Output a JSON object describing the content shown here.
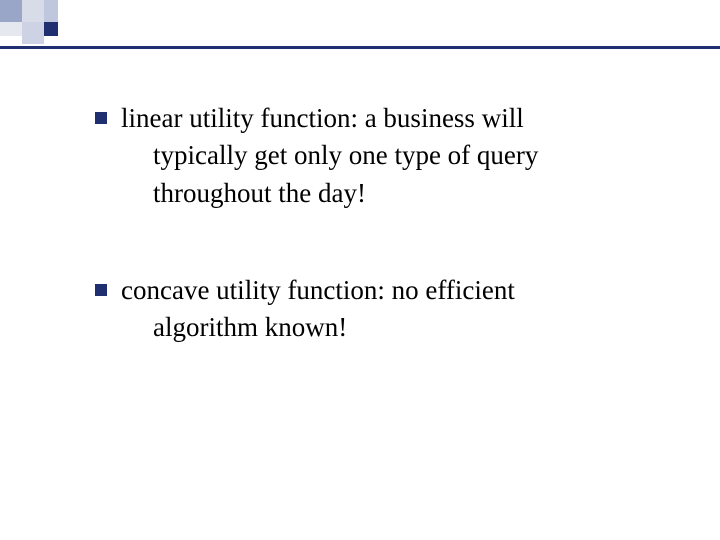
{
  "slide": {
    "bullets": [
      {
        "lead": "linear utility function:  a business will",
        "rest": "typically get only one type of query throughout the day!"
      },
      {
        "lead": "concave utility function:  no efficient",
        "rest": "algorithm known!"
      }
    ]
  }
}
